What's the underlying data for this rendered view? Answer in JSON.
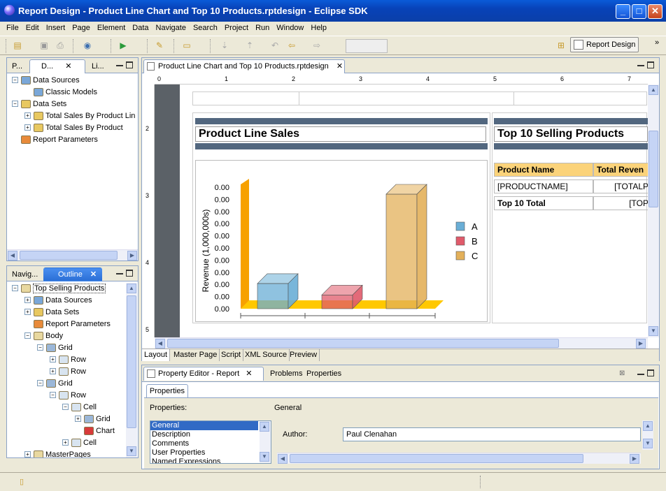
{
  "window": {
    "title": "Report Design - Product Line Chart and Top 10 Products.rptdesign - Eclipse SDK",
    "min": "_",
    "max": "□",
    "close": "✕"
  },
  "menu": [
    "File",
    "Edit",
    "Insert",
    "Page",
    "Element",
    "Data",
    "Navigate",
    "Search",
    "Project",
    "Run",
    "Window",
    "Help"
  ],
  "toolbar": {
    "perspective_label": "Report Design"
  },
  "data_explorer": {
    "tabs": [
      "P...",
      "D...",
      "Li..."
    ],
    "items": [
      {
        "label": "Data Sources",
        "level": 0,
        "exp": "−"
      },
      {
        "label": "Classic Models",
        "level": 1,
        "exp": ""
      },
      {
        "label": "Data Sets",
        "level": 0,
        "exp": "−"
      },
      {
        "label": "Total Sales By Product Lin",
        "level": 1,
        "exp": "+"
      },
      {
        "label": "Total Sales By Product",
        "level": 1,
        "exp": "+"
      },
      {
        "label": "Report Parameters",
        "level": 0,
        "exp": ""
      }
    ]
  },
  "outline": {
    "tabs": [
      "Navig...",
      "Outline"
    ],
    "items": [
      {
        "label": "Top Selling Products",
        "level": 0,
        "exp": "−"
      },
      {
        "label": "Data Sources",
        "level": 1,
        "exp": "+"
      },
      {
        "label": "Data Sets",
        "level": 1,
        "exp": "+"
      },
      {
        "label": "Report Parameters",
        "level": 1,
        "exp": ""
      },
      {
        "label": "Body",
        "level": 1,
        "exp": "−"
      },
      {
        "label": "Grid",
        "level": 2,
        "exp": "−"
      },
      {
        "label": "Row",
        "level": 3,
        "exp": "+"
      },
      {
        "label": "Row",
        "level": 3,
        "exp": "+"
      },
      {
        "label": "Grid",
        "level": 2,
        "exp": "−"
      },
      {
        "label": "Row",
        "level": 3,
        "exp": "−"
      },
      {
        "label": "Cell",
        "level": 4,
        "exp": "−"
      },
      {
        "label": "Grid",
        "level": 5,
        "exp": "+"
      },
      {
        "label": "Chart",
        "level": 5,
        "exp": ""
      },
      {
        "label": "Cell",
        "level": 4,
        "exp": "+"
      },
      {
        "label": "MasterPages",
        "level": 1,
        "exp": "+"
      }
    ]
  },
  "editor": {
    "tab_label": "Product Line Chart and Top 10 Products.rptdesign",
    "ruler_h": [
      "0",
      "1",
      "2",
      "3",
      "4",
      "5",
      "6",
      "7"
    ],
    "ruler_v": [
      "2",
      "3",
      "4",
      "5"
    ],
    "bottom_tabs": [
      "Layout",
      "Master Page",
      "Script",
      "XML Source",
      "Preview"
    ]
  },
  "report": {
    "left_title": "Product Line Sales",
    "right_title": "Top 10 Selling Products",
    "table_headers": [
      "Product Name",
      "Total Reven"
    ],
    "rows": [
      [
        "[PRODUCTNAME]",
        "[TOTALP"
      ],
      [
        "Top 10 Total",
        "[TOP"
      ]
    ]
  },
  "chart_data": {
    "type": "bar",
    "categories": [
      "A",
      "B",
      "C"
    ],
    "series": [
      {
        "name": "A",
        "values": [
          2.2
        ]
      },
      {
        "name": "B",
        "values": [
          1.2
        ]
      },
      {
        "name": "C",
        "values": [
          10
        ]
      }
    ],
    "values": [
      2.2,
      1.2,
      10
    ],
    "ylabel": "Revenue (1,000,000s)",
    "tick_labels": [
      "0.00",
      "0.00",
      "0.00",
      "0.00",
      "0.00",
      "0.00",
      "0.00",
      "0.00",
      "0.00",
      "0.00",
      "0.00"
    ],
    "legend": [
      "A",
      "B",
      "C"
    ],
    "colors": {
      "A": "#6aaed6",
      "B": "#e05a6a",
      "C": "#e3b05a"
    }
  },
  "property_editor": {
    "tabs": [
      "Property Editor - Report",
      "Problems",
      "Properties"
    ],
    "subtab": "Properties",
    "properties_label": "Properties:",
    "section_label": "General",
    "list": [
      "General",
      "Description",
      "Comments",
      "User Properties",
      "Named Expressions"
    ],
    "author_label": "Author:",
    "author_value": "Paul Clenahan"
  }
}
